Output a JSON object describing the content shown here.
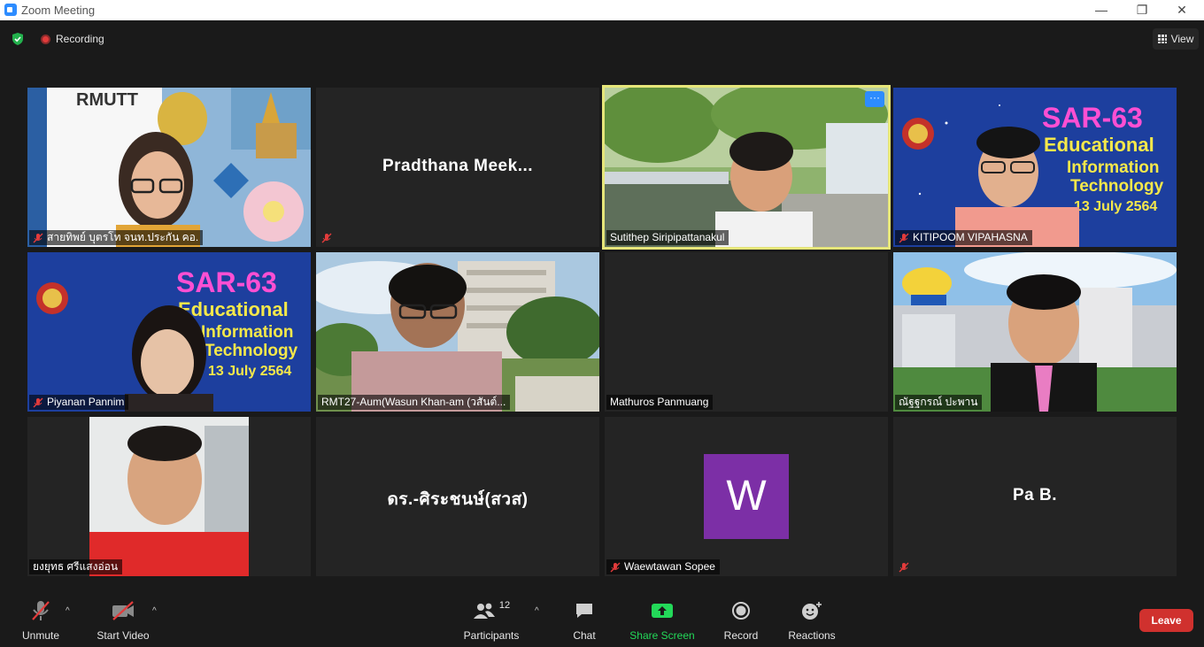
{
  "window": {
    "title": "Zoom Meeting",
    "minimize": "—",
    "restore": "❐",
    "close": "✕"
  },
  "topbar": {
    "recording_label": "Recording",
    "view_label": "View"
  },
  "participants": [
    {
      "name": "สายทิพย์ บุตรโท จนท.ประกัน คอ.",
      "muted": true
    },
    {
      "name": "",
      "display_name": "Pradthana  Meek...",
      "muted": true
    },
    {
      "name": "Sutithep Siripipattanakul",
      "muted": false,
      "active": true
    },
    {
      "name": "KITIPOOM VIPAHASNA",
      "muted": true
    },
    {
      "name": "Piyanan Pannim",
      "muted": true
    },
    {
      "name": "RMT27-Aum(Wasun Khan-am (วสันต์...",
      "muted": false
    },
    {
      "name": "Mathuros Panmuang",
      "muted": false
    },
    {
      "name": "ณัฐฐกรณ์ ปะพาน",
      "muted": false
    },
    {
      "name": "ยงยุทธ ศรีแสงอ่อน",
      "muted": false
    },
    {
      "name": "",
      "display_name": "ดร.-ศิระชนษ์(สวส)",
      "muted": false
    },
    {
      "name": "Waewtawan Sopee",
      "muted": true,
      "avatar_letter": "W"
    },
    {
      "name": "",
      "display_name": "Pa B.",
      "muted": true
    }
  ],
  "slides": {
    "sar_title": "SAR-63",
    "sar_line1": "Educational",
    "sar_line2": "Information",
    "sar_line3": "Technology",
    "sar_date": "13 July 2564",
    "rmutt_logo": "RMUTT"
  },
  "toolbar": {
    "unmute": "Unmute",
    "start_video": "Start Video",
    "participants": "Participants",
    "participants_count": "12",
    "chat": "Chat",
    "share_screen": "Share Screen",
    "record": "Record",
    "reactions": "Reactions",
    "leave": "Leave"
  },
  "colors": {
    "active_border": "#e6e67a",
    "share_green": "#23d959",
    "leave_red": "#d0312e",
    "avatar_purple": "#7c2fa6"
  }
}
